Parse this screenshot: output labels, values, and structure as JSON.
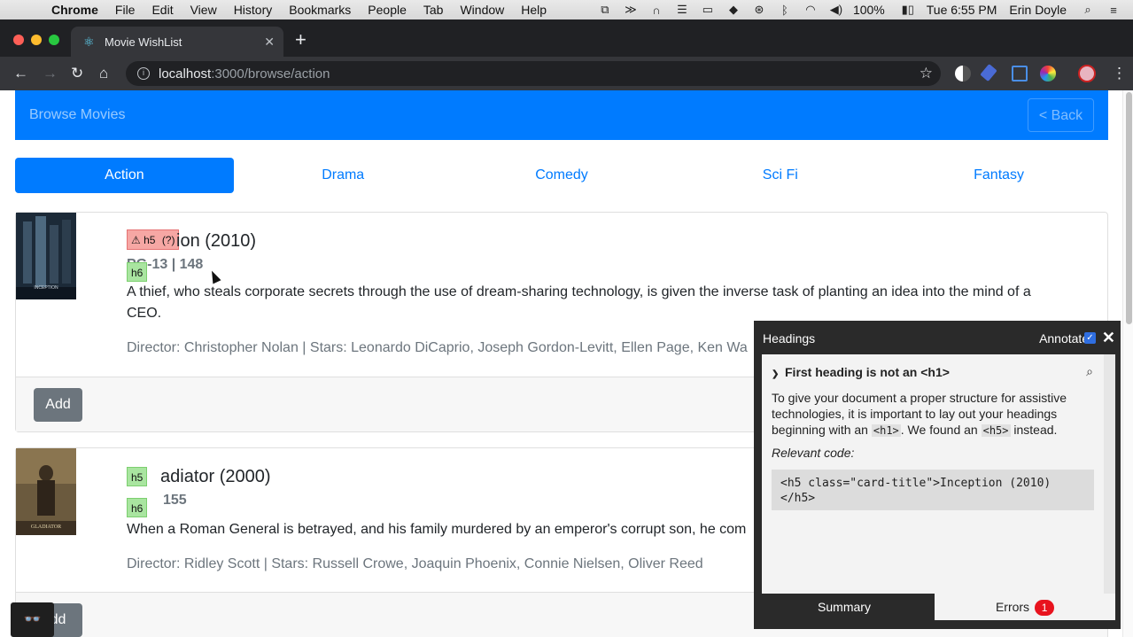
{
  "menubar": {
    "app": "Chrome",
    "items": [
      "File",
      "Edit",
      "View",
      "History",
      "Bookmarks",
      "People",
      "Tab",
      "Window",
      "Help"
    ],
    "battery": "100%",
    "clock": "Tue 6:55 PM",
    "user": "Erin Doyle"
  },
  "browser": {
    "tab_title": "Movie WishList",
    "url_host": "localhost",
    "url_path": ":3000/browse/action"
  },
  "navbar": {
    "brand": "Browse Movies",
    "back_label": "< Back"
  },
  "categories": [
    "Action",
    "Drama",
    "Comedy",
    "Sci Fi",
    "Fantasy"
  ],
  "active_category": "Action",
  "movies": [
    {
      "title": "Inception (2010)",
      "title_visible": "ion (2010)",
      "meta": "PG-13 | 148",
      "meta_visible": "PG-13 | 148",
      "description": "A thief, who steals corporate secrets through the use of dream-sharing technology, is given the inverse task of planting an idea into the mind of a CEO.",
      "credits": "Director: Christopher Nolan | Stars: Leonardo DiCaprio, Joseph Gordon-Levitt, Ellen Page, Ken Wa",
      "poster_text": "INCEPTION",
      "add_label": "Add",
      "h5_badge": "h5",
      "h5_badge_extra": "(?)",
      "h6_badge": "h6"
    },
    {
      "title": "Gladiator (2000)",
      "title_visible": "adiator (2000)",
      "meta": "R | 155",
      "meta_visible": "155",
      "description": "When a Roman General is betrayed, and his family murdered by an emperor's corrupt son, he com",
      "credits": "Director: Ridley Scott | Stars: Russell Crowe, Joaquin Phoenix, Connie Nielsen, Oliver Reed",
      "poster_text": "GLADIATOR",
      "add_label": "dd",
      "h5_badge": "h5",
      "h6_badge": "h6"
    }
  ],
  "headings_panel": {
    "title": "Headings",
    "annotate_label": "Annotate:",
    "issue_title": "First heading is not an <h1>",
    "issue_text_1": "To give your document a proper structure for assistive technologies, it is important to lay out your headings beginning with an ",
    "issue_code_1": "<h1>",
    "issue_text_2": ". We found an ",
    "issue_code_2": "<h5>",
    "issue_text_3": " instead.",
    "relevant_label": "Relevant code:",
    "code_line_1": "<h5 class=\"card-title\">Inception (2010)",
    "code_line_2": "</h5>",
    "tab_summary": "Summary",
    "tab_errors": "Errors",
    "error_count": "1"
  },
  "colors": {
    "primary": "#007bff",
    "error_badge": "#e8131e",
    "h5_warning": "#f6a7a4",
    "heading_ok": "#a9e5a0"
  }
}
